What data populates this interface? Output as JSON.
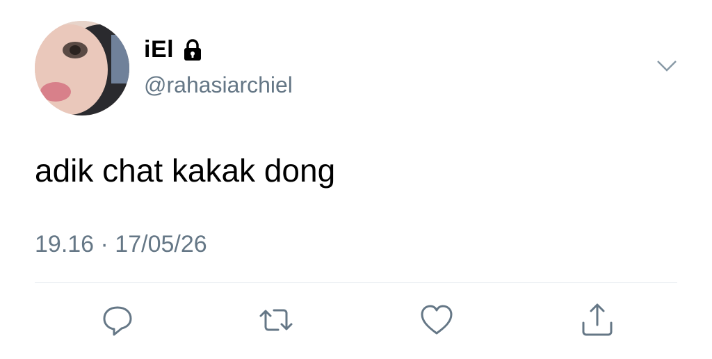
{
  "tweet": {
    "display_name": "iEl",
    "handle": "@rahasiarchiel",
    "text": "adik chat kakak dong",
    "timestamp": "19.16 · 17/05/26"
  },
  "icons": {
    "lock": "lock-icon",
    "chevron": "chevron-down-icon",
    "reply": "reply-icon",
    "retweet": "retweet-icon",
    "like": "heart-icon",
    "share": "share-icon"
  },
  "colors": {
    "secondary_text": "#657786",
    "divider": "#e1e8ed",
    "icon": "#657786"
  }
}
